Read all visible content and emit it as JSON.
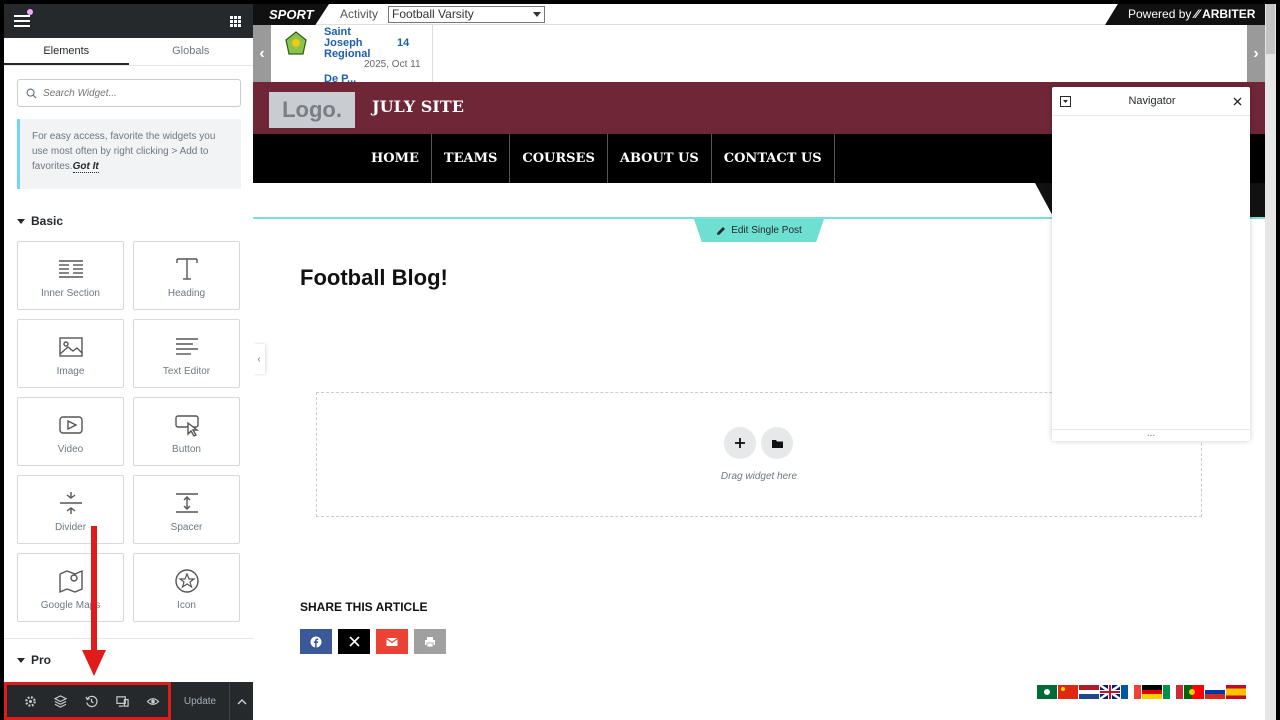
{
  "panel": {
    "tabs": [
      {
        "label": "Elements"
      },
      {
        "label": "Globals"
      }
    ],
    "search_placeholder": "Search Widget...",
    "tip": {
      "text": "For easy access, favorite the widgets you use most often by right clicking > Add to favorites.",
      "link": "Got It"
    },
    "sections": {
      "basic": "Basic",
      "pro": "Pro"
    },
    "widgets": [
      {
        "label": "Inner Section",
        "icon": "inner-section-icon"
      },
      {
        "label": "Heading",
        "icon": "heading-icon"
      },
      {
        "label": "Image",
        "icon": "image-icon"
      },
      {
        "label": "Text Editor",
        "icon": "text-editor-icon"
      },
      {
        "label": "Video",
        "icon": "video-icon"
      },
      {
        "label": "Button",
        "icon": "button-icon"
      },
      {
        "label": "Divider",
        "icon": "divider-icon"
      },
      {
        "label": "Spacer",
        "icon": "spacer-icon"
      },
      {
        "label": "Google Maps",
        "icon": "google-maps-icon"
      },
      {
        "label": "Icon",
        "icon": "star-icon"
      }
    ],
    "footer": {
      "icons": [
        "settings-icon",
        "layers-icon",
        "history-icon",
        "responsive-icon",
        "preview-icon"
      ],
      "update_label": "Update"
    },
    "annotation_color": "#e01b1b"
  },
  "topbar": {
    "sport_label": "SPORT",
    "activity_label": "Activity",
    "activity_value": "Football Varsity",
    "powered_label": "Powered by",
    "powered_brand": "ARBITER"
  },
  "scoreboard": {
    "team1": "Saint Joseph Regional",
    "score1": "14",
    "date": "2025, Oct 11",
    "team2_partial": "De P..."
  },
  "site": {
    "logo_text": "Logo.",
    "title": "JULY SITE",
    "header_color": "#6f2637",
    "menu": [
      {
        "label": "HOME"
      },
      {
        "label": "TEAMS"
      },
      {
        "label": "COURSES"
      },
      {
        "label": "ABOUT US"
      },
      {
        "label": "CONTACT US"
      }
    ]
  },
  "edit_post_label": "Edit Single Post",
  "post": {
    "title": "Football Blog!",
    "drop_label": "Drag widget here",
    "share_title": "SHARE THIS ARTICLE",
    "share_buttons": [
      {
        "icon": "facebook-icon",
        "color": "#3b5998"
      },
      {
        "icon": "x-icon",
        "color": "#000000"
      },
      {
        "icon": "email-icon",
        "color": "#ea4335"
      },
      {
        "icon": "print-icon",
        "color": "#a0a0a0"
      }
    ]
  },
  "navigator": {
    "title": "Navigator",
    "footer": "..."
  },
  "languages": [
    "Arabic",
    "Chinese",
    "Dutch",
    "English",
    "French",
    "German",
    "Italian",
    "Portuguese",
    "Russian",
    "Spanish"
  ]
}
